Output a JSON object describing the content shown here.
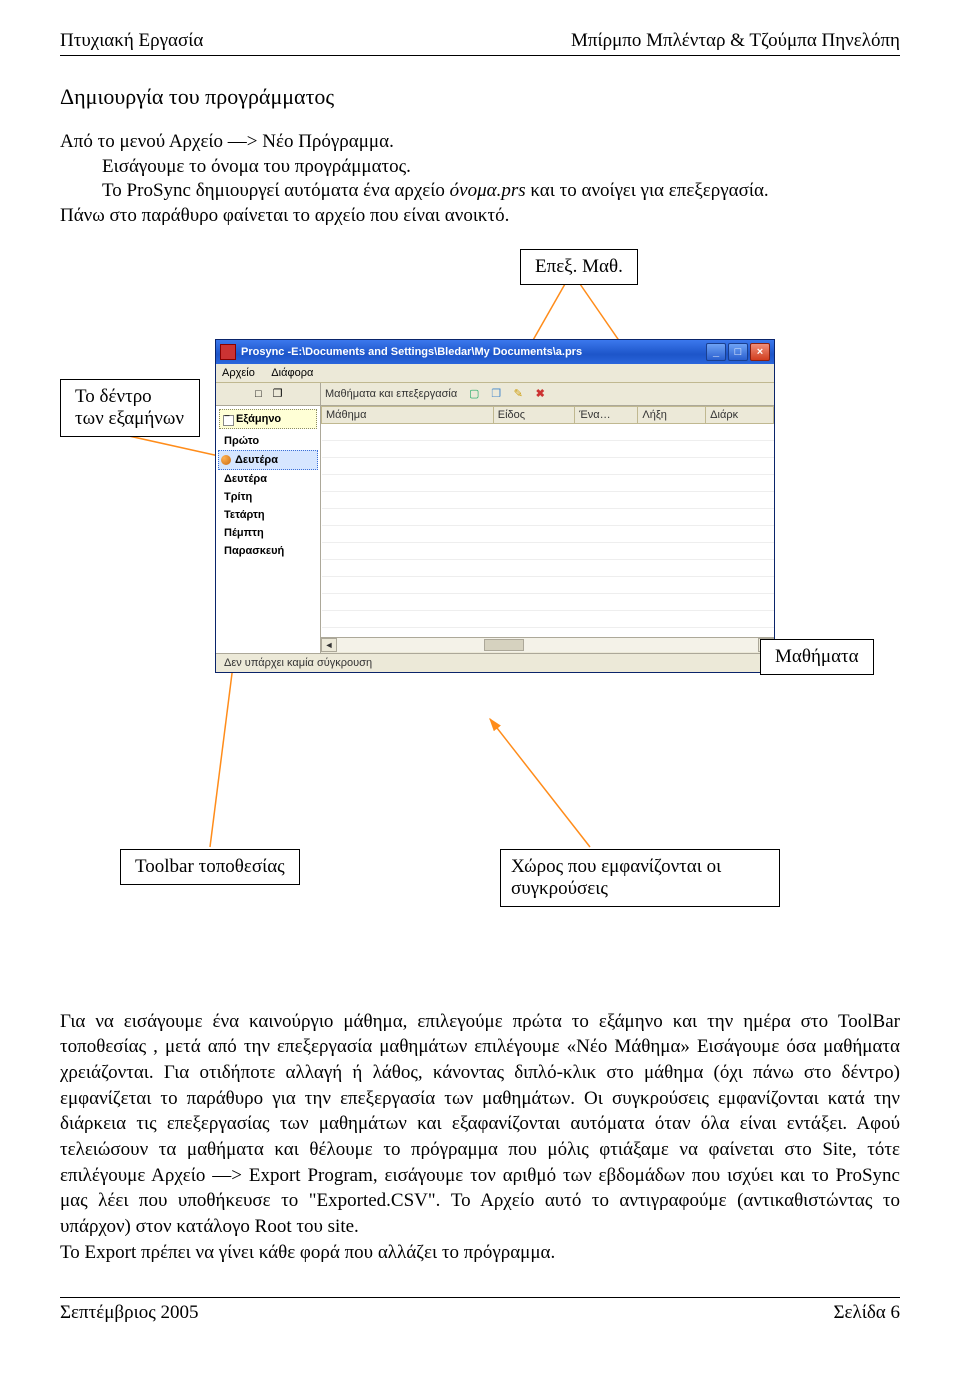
{
  "header": {
    "left": "Πτυχιακή Εργασία",
    "right": "Μπίρμπο Μπλένταρ & Τζούμπα Πηνελόπη"
  },
  "section_title": "Δημιουργία του προγράμματος",
  "intro_lines": {
    "l1": "Από το μενού Αρχείο —> Νέο Πρόγραμμα.",
    "l2": "Εισάγουμε το όνομα του προγράμματος.",
    "l3a": "Το ProSync δημιουργεί αυτόματα ένα αρχείο ",
    "l3b": "όνομα.prs",
    "l3c": " και το ανοίγει για επεξεργασία.",
    "l4": "Πάνω στο παράθυρο φαίνεται το αρχείο που είναι ανοικτό."
  },
  "labels": {
    "epex": "Επεξ. Μαθ.",
    "tree": "Το δέντρο των εξαμήνων",
    "mathimata": "Μαθήματα",
    "toolbar": "Toolbar τοποθεσίας",
    "conflicts": "Χώρος που εμφανίζονται οι συγκρούσεις"
  },
  "window": {
    "title": "Prosync -E:\\Documents and Settings\\Bledar\\My Documents\\a.prs",
    "menu": {
      "file": "Αρχείο",
      "misc": "Διάφορα"
    },
    "toolbar_text": "Μαθήματα και επεξεργασία",
    "sidebar_header_icons": {
      "new": "□",
      "copy": "❐"
    }
  },
  "sidebar_days": {
    "semester": "Εξάμηνο",
    "first": "Πρώτο",
    "mon": "Δευτέρα",
    "mon2": "Δευτέρα",
    "tue": "Τρίτη",
    "wed": "Τετάρτη",
    "thu": "Πέμπτη",
    "fri": "Παρασκευή"
  },
  "grid_headers": {
    "c1": "Μάθημα",
    "c2": "Είδος",
    "c3": "Ένα…",
    "c4": "Λήξη",
    "c5": "Διάρκ"
  },
  "statusbar": "Δεν υπάρχει καμία σύγκρουση",
  "paragraph": "Για να εισάγουμε ένα καινούργιο μάθημα, επιλεγούμε πρώτα το εξάμηνο και την ημέρα στο ToolBar τοποθεσίας , μετά από την επεξεργασία μαθημάτων επιλέγουμε «Νέο Μάθημα» Εισάγουμε όσα μαθήματα χρειάζονται. Για οτιδήποτε αλλαγή ή λάθος, κάνοντας διπλό-κλικ στο μάθημα (όχι πάνω στο δέντρο) εμφανίζεται το παράθυρο για την επεξεργασία των μαθημάτων. Οι συγκρούσεις εμφανίζονται κατά την διάρκεια τις επεξεργασίας των μαθημάτων και εξαφανίζονται αυτόματα όταν όλα είναι εντάξει. Αφού τελειώσουν τα μαθήματα και θέλουμε το πρόγραμμα που μόλις φτιάξαμε να φαίνεται στο Site, τότε επιλέγουμε Αρχείο —> Export Program, εισάγουμε τον αριθμό των εβδομάδων που ισχύει και το ProSync μας λέει που υποθήκευσε το \"Exported.CSV\". Το Αρχείο αυτό το αντιγραφούμε (αντικαθιστώντας το υπάρχον) στον κατάλογο Root του site.",
  "paragraph_last": "Το Export πρέπει να γίνει κάθε φορά που αλλάζει το πρόγραμμα.",
  "footer": {
    "left": "Σεπτέμβριος 2005",
    "right": "Σελίδα 6"
  }
}
